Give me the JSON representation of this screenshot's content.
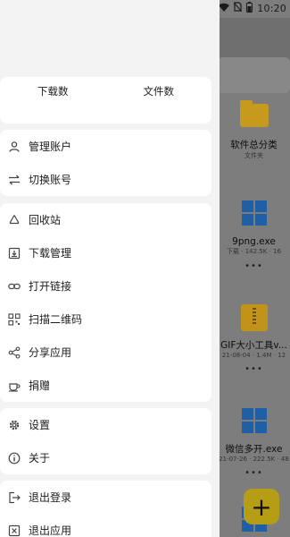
{
  "status_bar": {
    "time": "10:20"
  },
  "background_app": {
    "items": [
      {
        "name": "软件总分类",
        "meta": "文件夹",
        "kind": "folder"
      },
      {
        "name": "9png.exe",
        "meta": "下载 · 142.5K · 16",
        "kind": "exe"
      },
      {
        "name": "GIF大小工具v...",
        "meta": "21-08-04 · 1.4M · 12",
        "kind": "zip"
      },
      {
        "name": "微信多开.exe",
        "meta": "21-07-26 · 222.5K · 48",
        "kind": "exe"
      }
    ],
    "more_label": "•••",
    "fab_label": "+"
  },
  "drawer": {
    "stats": [
      {
        "label": "下载数",
        "value": ""
      },
      {
        "label": "文件数",
        "value": ""
      }
    ],
    "account_group": [
      {
        "icon": "user-icon",
        "label": "管理账户"
      },
      {
        "icon": "swap-icon",
        "label": "切换账号"
      }
    ],
    "tools_group": [
      {
        "icon": "recycle-icon",
        "label": "回收站"
      },
      {
        "icon": "download-box-icon",
        "label": "下载管理"
      },
      {
        "icon": "link-icon",
        "label": "打开链接"
      },
      {
        "icon": "qr-code-icon",
        "label": "扫描二维码"
      },
      {
        "icon": "share-icon",
        "label": "分享应用"
      },
      {
        "icon": "coffee-cup-icon",
        "label": "捐赠"
      }
    ],
    "settings_group": [
      {
        "icon": "gear-icon",
        "label": "设置"
      },
      {
        "icon": "info-icon",
        "label": "关于"
      }
    ],
    "exit_group": [
      {
        "icon": "logout-icon",
        "label": "退出登录"
      },
      {
        "icon": "close-box-icon",
        "label": "退出应用"
      }
    ]
  }
}
